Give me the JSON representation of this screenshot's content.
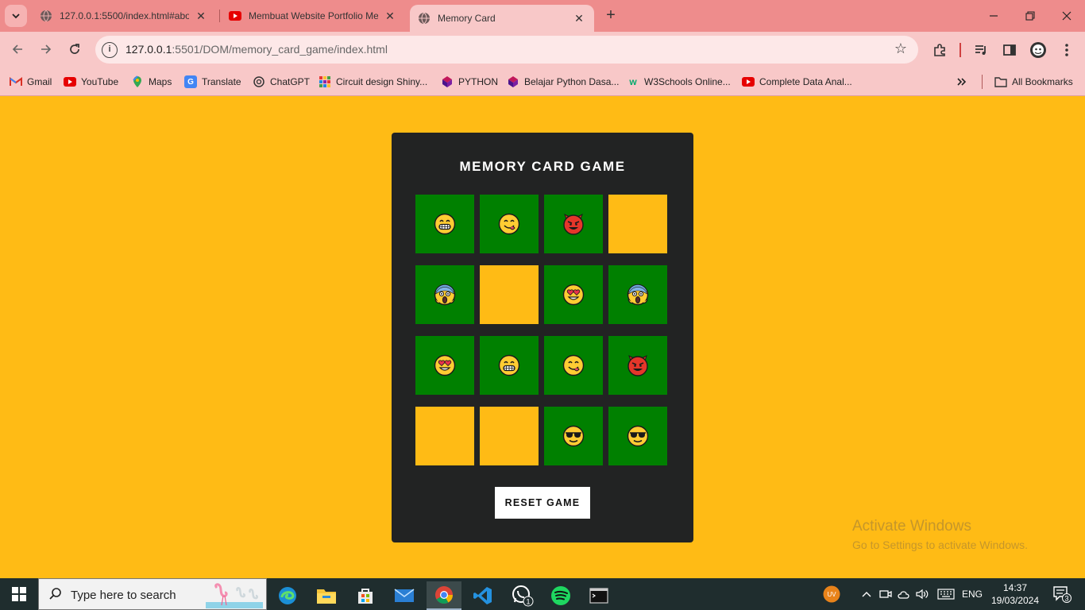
{
  "browser": {
    "tabs": [
      {
        "title": "127.0.0.1:5500/index.html#abou",
        "active": false,
        "favicon": "globe-icon"
      },
      {
        "title": "Membuat Website Portfolio Me",
        "active": false,
        "favicon": "youtube-icon"
      },
      {
        "title": "Memory Card",
        "active": true,
        "favicon": "globe-icon"
      }
    ],
    "url_host": "127.0.0.1",
    "url_path": ":5501/DOM/memory_card_game/index.html",
    "bookmarks": [
      {
        "label": "Gmail",
        "icon": "gmail-icon"
      },
      {
        "label": "YouTube",
        "icon": "youtube-icon"
      },
      {
        "label": "Maps",
        "icon": "maps-icon"
      },
      {
        "label": "Translate",
        "icon": "translate-icon"
      },
      {
        "label": "ChatGPT",
        "icon": "chatgpt-icon"
      },
      {
        "label": "Circuit design Shiny...",
        "icon": "circuit-icon"
      },
      {
        "label": "PYTHON",
        "icon": "python-icon"
      },
      {
        "label": "Belajar Python Dasa...",
        "icon": "python-icon"
      },
      {
        "label": "W3Schools Online...",
        "icon": "w3schools-icon"
      },
      {
        "label": "Complete Data Anal...",
        "icon": "youtube-icon"
      }
    ],
    "all_bookmarks_label": "All Bookmarks"
  },
  "game": {
    "title": "MEMORY CARD GAME",
    "reset_label": "RESET GAME",
    "cards": [
      {
        "face": "grin",
        "revealed": true
      },
      {
        "face": "yum",
        "revealed": true
      },
      {
        "face": "devil",
        "revealed": true
      },
      {
        "face": "",
        "revealed": false
      },
      {
        "face": "scream",
        "revealed": true
      },
      {
        "face": "",
        "revealed": false
      },
      {
        "face": "heart-eyes",
        "revealed": true
      },
      {
        "face": "scream",
        "revealed": true
      },
      {
        "face": "heart-eyes",
        "revealed": true
      },
      {
        "face": "grin",
        "revealed": true
      },
      {
        "face": "yum",
        "revealed": true
      },
      {
        "face": "devil",
        "revealed": true
      },
      {
        "face": "",
        "revealed": false
      },
      {
        "face": "",
        "revealed": false
      },
      {
        "face": "sunglasses",
        "revealed": true
      },
      {
        "face": "sunglasses",
        "revealed": true
      }
    ],
    "colors": {
      "background": "#ffbb15",
      "panel": "#222323",
      "card_revealed": "#008000",
      "card_hidden": "#ffbb15"
    }
  },
  "watermark": {
    "line1": "Activate Windows",
    "line2": "Go to Settings to activate Windows."
  },
  "taskbar": {
    "search_placeholder": "Type here to search",
    "whatsapp_badge": "1",
    "language": "ENG",
    "time": "14:37",
    "date": "19/03/2024",
    "notification_count": "3",
    "avatar_initials": "UV"
  }
}
